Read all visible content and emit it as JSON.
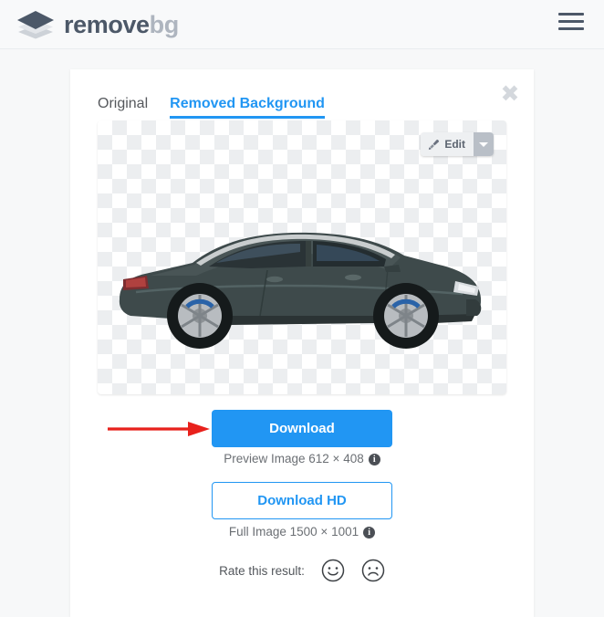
{
  "header": {
    "logo_icon": "layers-diamond-icon",
    "brand_primary": "remove",
    "brand_secondary": "bg",
    "menu_icon": "hamburger-menu-icon"
  },
  "card": {
    "close_icon": "close-x-icon",
    "tabs": [
      {
        "label": "Original",
        "active": false
      },
      {
        "label": "Removed Background",
        "active": true
      }
    ],
    "preview": {
      "background": "transparency-checkerboard",
      "subject": "dark-gray-bmw-coupe-side-view",
      "edit_button": {
        "label": "Edit",
        "icon": "paintbrush-icon",
        "caret_icon": "chevron-down-icon"
      }
    },
    "download": {
      "primary_label": "Download",
      "primary_caption": "Preview Image 612 × 408",
      "primary_info_icon": "info-circle-icon",
      "hd_label": "Download HD",
      "hd_caption": "Full Image 1500 × 1001",
      "hd_info_icon": "info-circle-icon"
    },
    "rating": {
      "label": "Rate this result:",
      "positive_icon": "smiley-face-icon",
      "negative_icon": "frowny-face-icon"
    }
  },
  "annotation": {
    "arrow_icon": "red-right-arrow",
    "color": "#e8211c"
  },
  "colors": {
    "accent_blue": "#2196f3",
    "brand_dark": "#4c5868",
    "brand_light": "#aeb5bf",
    "page_bg": "#f7f8f9",
    "card_bg": "#ffffff",
    "checker_light": "#ffffff",
    "checker_dark": "#eceef0"
  }
}
